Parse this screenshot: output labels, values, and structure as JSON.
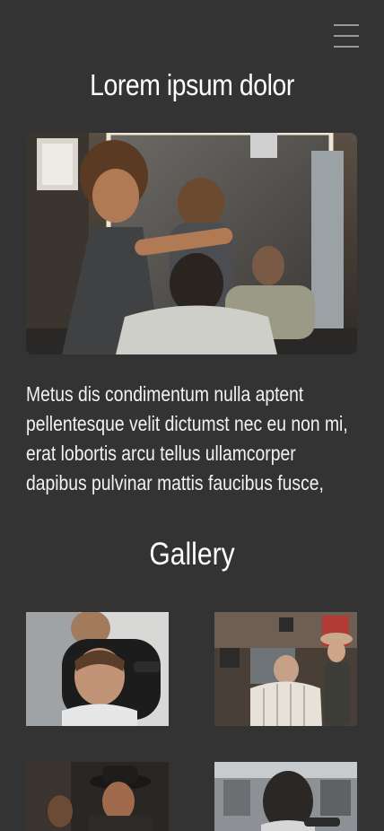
{
  "header": {
    "menu_icon": "hamburger-menu-icon",
    "title": "Lorem ipsum dolor"
  },
  "hero": {
    "image": "barber-cutting-hair-photo"
  },
  "intro": {
    "text": "Metus dis condimentum nulla aptent pellentesque velit dictumst nec eu non mi, erat lobortis arcu tellus ullamcorper dapibus pulvinar mattis faucibus fusce,"
  },
  "gallery": {
    "title": "Gallery",
    "items": [
      {
        "image": "barber-fade-haircut-photo"
      },
      {
        "image": "barbershop-chair-photo"
      },
      {
        "image": "man-in-hat-photo"
      },
      {
        "image": "haircut-back-view-photo"
      }
    ]
  },
  "colors": {
    "background": "#333333",
    "text": "#ffffff",
    "menu_bar": "#9a9a9a"
  }
}
